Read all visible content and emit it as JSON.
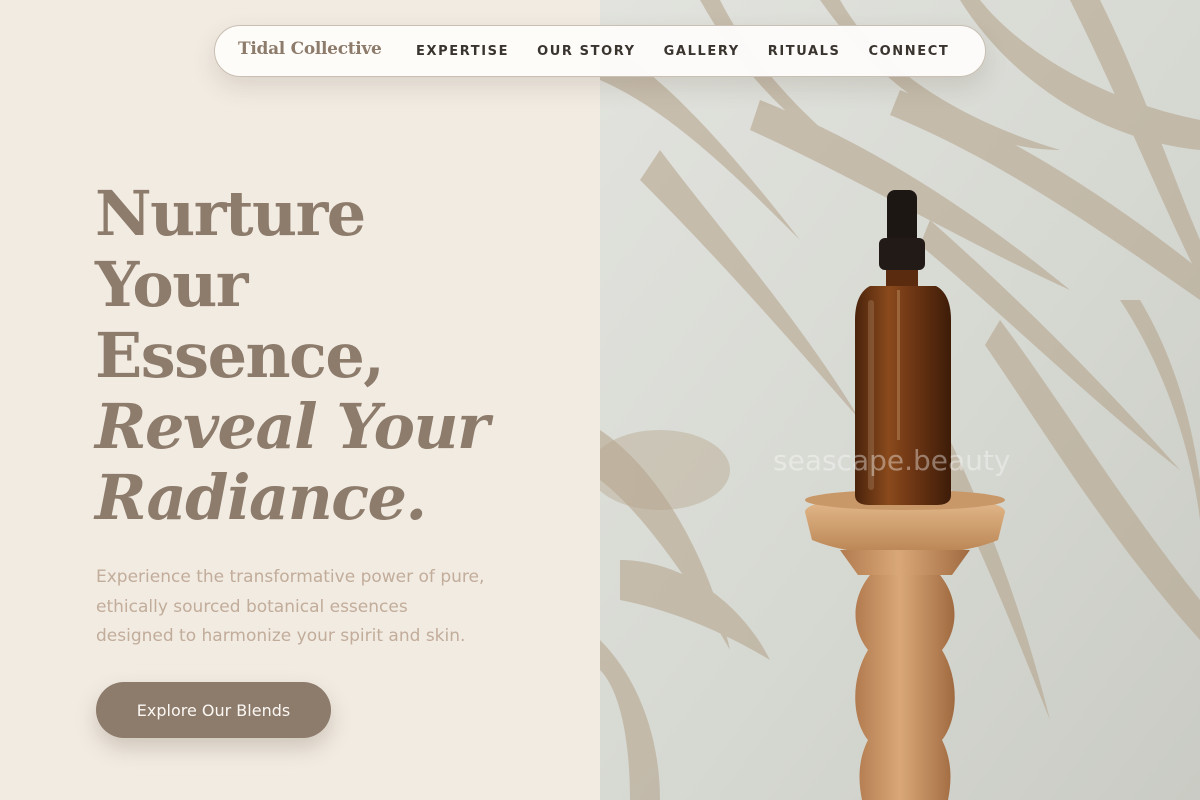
{
  "brand": "Tidal Collective",
  "nav": {
    "items": [
      {
        "label": "EXPERTISE"
      },
      {
        "label": "OUR STORY"
      },
      {
        "label": "GALLERY"
      },
      {
        "label": "RITUALS"
      },
      {
        "label": "CONNECT"
      }
    ]
  },
  "hero": {
    "headline_line1": "Nurture",
    "headline_line2": "Your",
    "headline_line3": "Essence,",
    "headline_italic_line1": "Reveal Your",
    "headline_italic_line2": "Radiance.",
    "description_lines": [
      "Experience the transformative power of pure,",
      "ethically sourced botanical essences",
      "designed to harmonize your spirit and skin."
    ],
    "cta_label": "Explore Our Blends"
  },
  "watermark": "seascape.beauty",
  "colors": {
    "accent": "#8d7b6b",
    "background": "#f1ebe2",
    "nav_text": "#3a342f",
    "description_text": "#c2ac9a",
    "button_text": "#fbf8f4"
  }
}
